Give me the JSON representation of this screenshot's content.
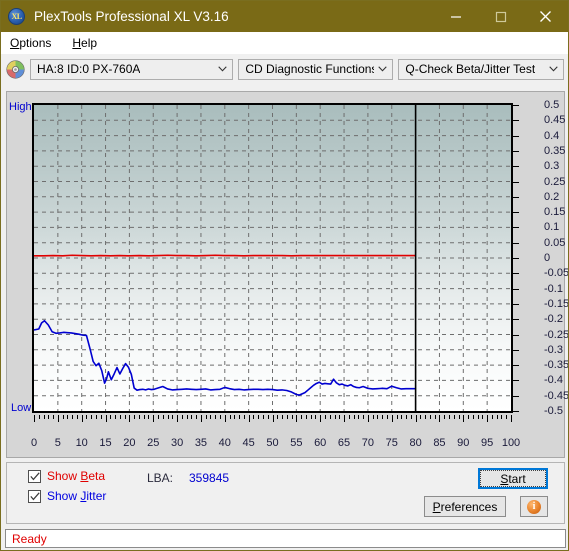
{
  "window": {
    "title": "PlexTools Professional XL V3.16",
    "icon": "XL",
    "minimize_label": "minimize-icon",
    "maximize_label": "maximize-icon",
    "close_label": "close-icon",
    "titlebar_color": "#7a6a16"
  },
  "menu": {
    "items": [
      {
        "label": "Options",
        "accel": "O"
      },
      {
        "label": "Help",
        "accel": "H"
      }
    ]
  },
  "toolbar": {
    "drive_icon": "disc-icon",
    "drive": "HA:8 ID:0  PX-760A",
    "function": "CD Diagnostic Functions",
    "test": "Q-Check Beta/Jitter Test"
  },
  "chart_labels": {
    "high": "High",
    "low": "Low"
  },
  "controls": {
    "show_beta": {
      "label": "Show Beta",
      "accel": "B",
      "checked": true,
      "color": "#e00000"
    },
    "show_jitter": {
      "label": "Show Jitter",
      "accel": "J",
      "checked": true,
      "color": "#0000e0"
    },
    "lba_label": "LBA:",
    "lba_value": "359845",
    "start_label": "Start",
    "start_accel": "S",
    "preferences_label": "Preferences",
    "preferences_accel": "P",
    "info_label": "i"
  },
  "status": {
    "text": "Ready",
    "color": "#e00000"
  },
  "chart_data": {
    "type": "line",
    "title": "Q-Check Beta/Jitter Test",
    "xlabel": "",
    "ylabel": "",
    "xlim": [
      0,
      100
    ],
    "ylim": [
      -0.5,
      0.5
    ],
    "grid": true,
    "legend": "none",
    "xticks": [
      0,
      5,
      10,
      15,
      20,
      25,
      30,
      35,
      40,
      45,
      50,
      55,
      60,
      65,
      70,
      75,
      80,
      85,
      90,
      95,
      100
    ],
    "yticks": [
      0.5,
      0.45,
      0.4,
      0.35,
      0.3,
      0.25,
      0.2,
      0.15,
      0.1,
      0.05,
      0,
      -0.05,
      -0.1,
      -0.15,
      -0.2,
      -0.25,
      -0.3,
      -0.35,
      -0.4,
      -0.45,
      -0.5
    ],
    "ytick_labels": [
      "0.5",
      "0.45",
      "0.4",
      "0.35",
      "0.3",
      "0.25",
      "0.2",
      "0.15",
      "0.1",
      "0.05",
      "0",
      "-0.05",
      "-0.1",
      "-0.15",
      "-0.2",
      "-0.25",
      "-0.3",
      "-0.35",
      "-0.4",
      "-0.45",
      "-0.5"
    ],
    "data_end_marker_x": 80,
    "series": [
      {
        "name": "Beta",
        "color": "#e00000",
        "x": [
          0,
          2,
          4,
          6,
          8,
          10,
          12,
          14,
          16,
          18,
          20,
          22,
          24,
          26,
          28,
          30,
          32,
          34,
          36,
          38,
          40,
          42,
          44,
          46,
          48,
          50,
          52,
          54,
          56,
          58,
          60,
          62,
          64,
          66,
          68,
          70,
          72,
          74,
          76,
          78,
          80
        ],
        "values": [
          0.007,
          0.007,
          0.008,
          0.007,
          0.009,
          0.008,
          0.007,
          0.008,
          0.007,
          0.008,
          0.007,
          0.008,
          0.007,
          0.008,
          0.009,
          0.008,
          0.008,
          0.007,
          0.008,
          0.009,
          0.008,
          0.008,
          0.007,
          0.008,
          0.008,
          0.008,
          0.008,
          0.007,
          0.008,
          0.008,
          0.008,
          0.008,
          0.008,
          0.008,
          0.008,
          0.008,
          0.008,
          0.008,
          0.008,
          0.008,
          0.008
        ]
      },
      {
        "name": "Jitter",
        "color": "#0000d0",
        "x": [
          0,
          1,
          1.6,
          2.2,
          3,
          3.8,
          4.6,
          5.4,
          6.2,
          7,
          7.8,
          8.6,
          9.4,
          10.2,
          11,
          11.8,
          12.4,
          13,
          13.6,
          14.2,
          14.8,
          15.2,
          15.6,
          16.2,
          16.8,
          17.4,
          18,
          18.6,
          19.2,
          19.8,
          20.4,
          21,
          21.6,
          22.2,
          22.8,
          23.4,
          24,
          24.6,
          25.2,
          26,
          27,
          28,
          29,
          30,
          31,
          32,
          33,
          34,
          35,
          36,
          37,
          38,
          39,
          40,
          41,
          42,
          43,
          44,
          45,
          46,
          47,
          48,
          49,
          50,
          51,
          52,
          53,
          54,
          55,
          55.6,
          56.2,
          56.8,
          57.4,
          58,
          58.6,
          59.2,
          59.8,
          60.4,
          61,
          61.6,
          62.2,
          62.8,
          63.4,
          64,
          64.6,
          65.2,
          65.8,
          66.4,
          67,
          67.6,
          68.2,
          69,
          70,
          71,
          72,
          73,
          74,
          75,
          76,
          77,
          78,
          79,
          80
        ],
        "values": [
          -0.235,
          -0.232,
          -0.212,
          -0.205,
          -0.219,
          -0.241,
          -0.246,
          -0.245,
          -0.243,
          -0.244,
          -0.245,
          -0.247,
          -0.249,
          -0.252,
          -0.253,
          -0.3,
          -0.338,
          -0.352,
          -0.344,
          -0.368,
          -0.409,
          -0.395,
          -0.372,
          -0.398,
          -0.379,
          -0.358,
          -0.379,
          -0.361,
          -0.345,
          -0.357,
          -0.38,
          -0.425,
          -0.432,
          -0.43,
          -0.429,
          -0.431,
          -0.428,
          -0.43,
          -0.429,
          -0.425,
          -0.42,
          -0.428,
          -0.431,
          -0.43,
          -0.429,
          -0.428,
          -0.429,
          -0.43,
          -0.429,
          -0.428,
          -0.431,
          -0.43,
          -0.429,
          -0.423,
          -0.427,
          -0.43,
          -0.429,
          -0.431,
          -0.43,
          -0.429,
          -0.429,
          -0.43,
          -0.429,
          -0.43,
          -0.432,
          -0.431,
          -0.433,
          -0.438,
          -0.446,
          -0.448,
          -0.444,
          -0.44,
          -0.432,
          -0.424,
          -0.416,
          -0.41,
          -0.406,
          -0.412,
          -0.41,
          -0.411,
          -0.412,
          -0.396,
          -0.408,
          -0.414,
          -0.412,
          -0.416,
          -0.418,
          -0.414,
          -0.42,
          -0.423,
          -0.424,
          -0.42,
          -0.426,
          -0.428,
          -0.427,
          -0.426,
          -0.427,
          -0.419,
          -0.424,
          -0.428,
          -0.427,
          -0.427,
          -0.427
        ]
      }
    ]
  }
}
